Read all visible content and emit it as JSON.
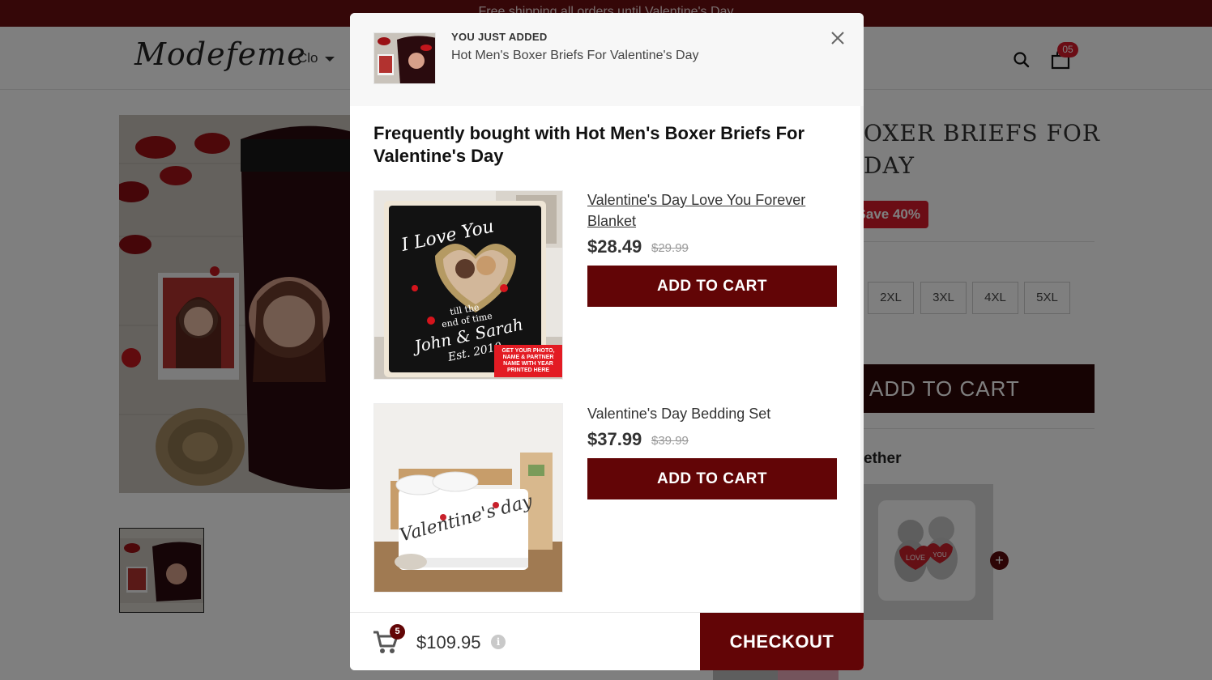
{
  "announcement": "Free shipping all orders until Valentine's Day",
  "header": {
    "logo": "Modefeme",
    "nav_item": "Clo",
    "cart_count": "05"
  },
  "product": {
    "title": "OXER BRIEFS FOR DAY",
    "save_badge": "Save 40%",
    "sizes": [
      "2XL",
      "3XL",
      "4XL",
      "5XL"
    ],
    "add_to_cart": "ADD TO CART",
    "together_label": "ether"
  },
  "modal": {
    "just_added_label": "YOU JUST ADDED",
    "just_added_name": "Hot Men's Boxer Briefs For Valentine's Day",
    "fbt_title": "Frequently bought with Hot Men's Boxer Briefs For Valentine's Day",
    "items": [
      {
        "name": "Valentine's Day Love You Forever Blanket",
        "price": "$28.49",
        "old_price": "$29.99",
        "button": "ADD TO CART"
      },
      {
        "name": "Valentine's Day Bedding Set",
        "price": "$37.99",
        "old_price": "$39.99",
        "button": "ADD TO CART"
      }
    ],
    "footer": {
      "cart_count": "5",
      "total": "$109.95",
      "checkout": "CHECKOUT"
    }
  },
  "blanket_text": {
    "line1": "I Love You",
    "line2": "till the",
    "line3": "end of time",
    "names": "John & Sarah",
    "est": "Est. 2010",
    "promo": "GET YOUR PHOTO, NAME & PARTNER NAME WITH YEAR PRINTED HERE"
  },
  "bedding_text": "Valentine's day",
  "pillow_text": {
    "left": "LOVE",
    "right": "YOU"
  },
  "colors": {
    "brand_dark": "#620506",
    "accent_red": "#d71a2b",
    "announce_bg": "#6b0e10"
  }
}
